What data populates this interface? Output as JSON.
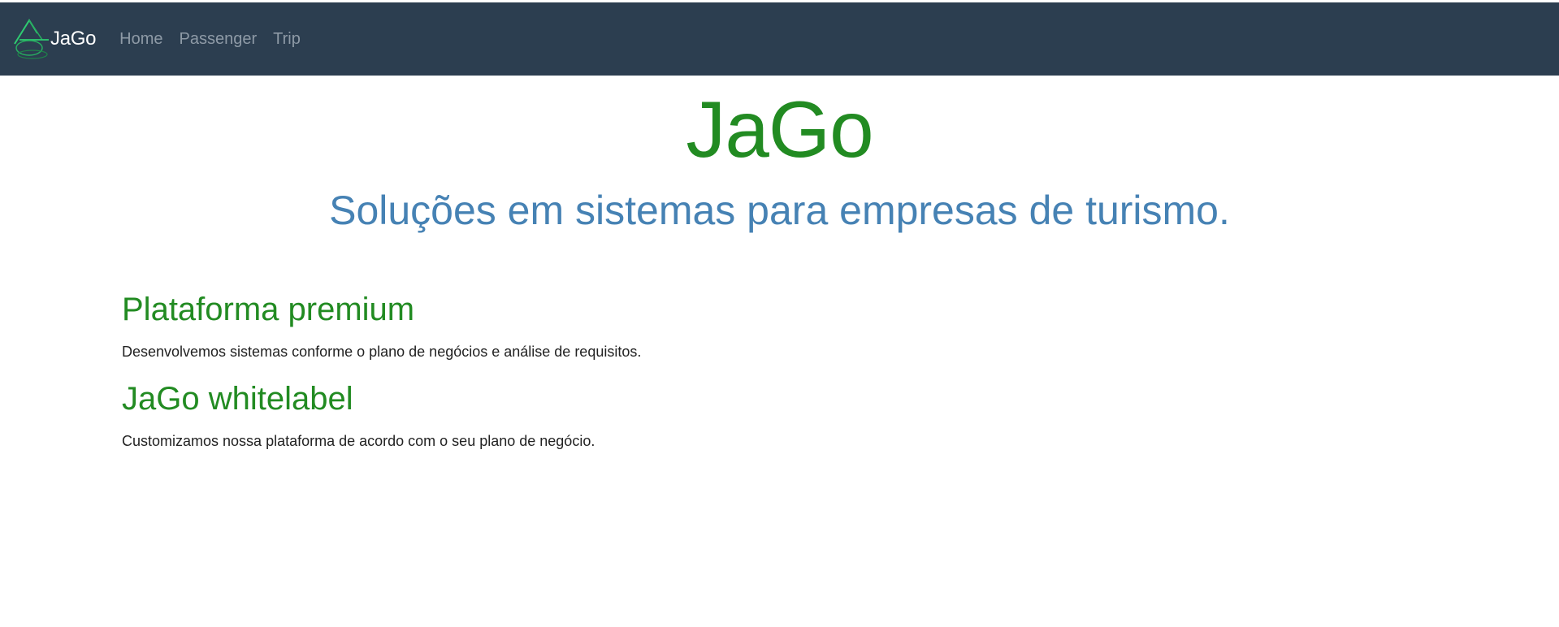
{
  "navbar": {
    "brand": "JaGo",
    "links": [
      "Home",
      "Passenger",
      "Trip"
    ]
  },
  "hero": {
    "title": "JaGo",
    "subtitle": "Soluções em sistemas para empresas de turismo."
  },
  "sections": [
    {
      "heading": "Plataforma premium",
      "text": "Desenvolvemos sistemas conforme o plano de negócios e análise de requisitos."
    },
    {
      "heading": "JaGo whitelabel",
      "text": "Customizamos nossa plataforma de acordo com o seu plano de negócio."
    }
  ],
  "colors": {
    "navbar_bg": "#2c3e50",
    "brand_green": "#228b22",
    "subtitle_blue": "#4682b4",
    "nav_link": "#8e9aa6"
  },
  "icons": {
    "brand_logo": "jago-logo-icon"
  }
}
